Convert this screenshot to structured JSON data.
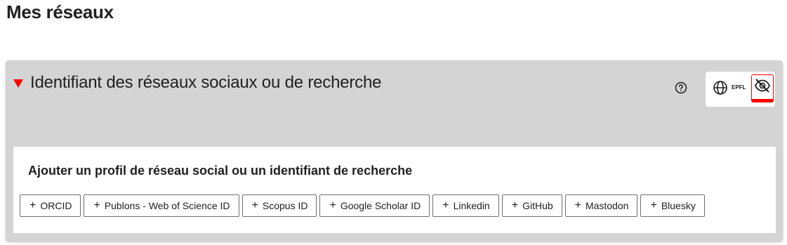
{
  "page": {
    "title": "Mes réseaux"
  },
  "panel": {
    "title": "Identifiant des réseaux sociaux ou de recherche",
    "visibility": {
      "epfl_label": "EPFL",
      "selected": "hidden"
    }
  },
  "add_section": {
    "title": "Ajouter un profil de réseau social ou un identifiant de recherche",
    "plus_symbol": "+",
    "buttons": [
      {
        "label": "ORCID"
      },
      {
        "label": "Publons - Web of Science ID"
      },
      {
        "label": "Scopus ID"
      },
      {
        "label": "Google Scholar ID"
      },
      {
        "label": "Linkedin"
      },
      {
        "label": "GitHub"
      },
      {
        "label": "Mastodon"
      },
      {
        "label": "Bluesky"
      }
    ]
  },
  "colors": {
    "accent": "#ff0000",
    "panel_bg": "#d4d4d4",
    "text": "#212121"
  }
}
